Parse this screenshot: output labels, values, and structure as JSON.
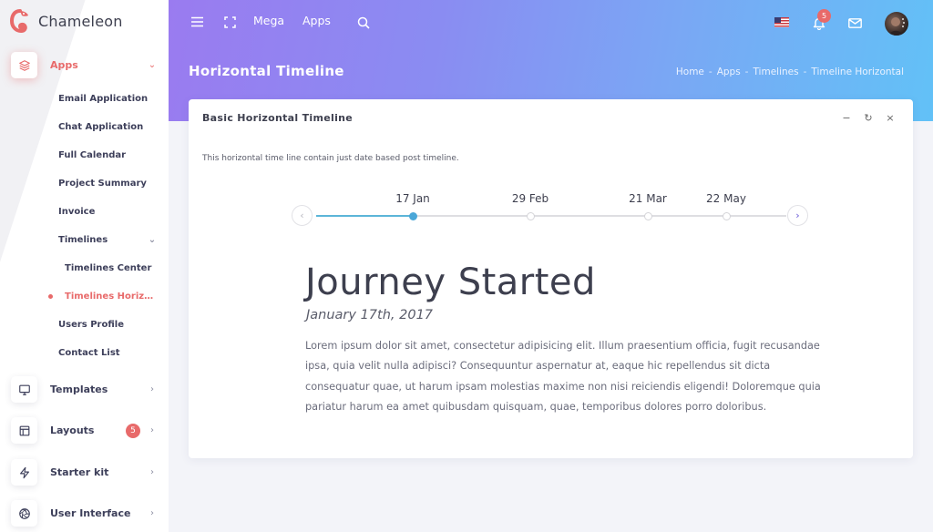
{
  "app": {
    "name": "Chameleon"
  },
  "sidebar": {
    "apps": {
      "label": "Apps",
      "icon": "layers-icon",
      "expanded": true
    },
    "sub_items": [
      {
        "label": "Email Application"
      },
      {
        "label": "Chat Application"
      },
      {
        "label": "Full Calendar"
      },
      {
        "label": "Project Summary"
      },
      {
        "label": "Invoice"
      },
      {
        "label": "Timelines",
        "expanded": true
      },
      {
        "label": "Users Profile"
      },
      {
        "label": "Contact List"
      }
    ],
    "timelines_children": [
      {
        "label": "Timelines Center",
        "active": false
      },
      {
        "label": "Timelines Horizon...",
        "active": true
      }
    ],
    "groups": [
      {
        "label": "Templates",
        "icon": "monitor-icon"
      },
      {
        "label": "Layouts",
        "icon": "layout-icon",
        "badge": "5"
      },
      {
        "label": "Starter kit",
        "icon": "lightning-icon"
      },
      {
        "label": "User Interface",
        "icon": "aperture-icon"
      }
    ]
  },
  "topbar": {
    "links": [
      "Mega",
      "Apps"
    ],
    "notification_count": "5",
    "language": "US flag"
  },
  "page": {
    "title": "Horizontal Timeline",
    "breadcrumb": [
      "Home",
      "Apps",
      "Timelines",
      "Timeline Horizontal"
    ],
    "breadcrumb_sep": "-"
  },
  "card": {
    "title": "Basic Horizontal Timeline",
    "tools": {
      "minimize": "−",
      "refresh": "↻",
      "close": "×"
    },
    "description": "This horizontal time line contain just date based post timeline."
  },
  "timeline": {
    "dates": [
      "17 Jan",
      "29 Feb",
      "21 Mar",
      "22 May"
    ],
    "active_index": 0,
    "prev": "‹",
    "next": "›",
    "event": {
      "title": "Journey Started",
      "date": "January 17th, 2017",
      "body": "Lorem ipsum dolor sit amet, consectetur adipisicing elit. Illum praesentium officia, fugit recusandae ipsa, quia velit nulla adipisci? Consequuntur aspernatur at, eaque hic repellendus sit dicta consequatur quae, ut harum ipsam molestias maxime non nisi reiciendis eligendi! Doloremque quia pariatur harum ea amet quibusdam quisquam, quae, temporibus dolores porro doloribus."
    }
  },
  "colors": {
    "accent": "#e86a6a",
    "timeline_active": "#4aa7d8",
    "gradient_start": "#9a7bf0",
    "gradient_end": "#62c1f7"
  }
}
